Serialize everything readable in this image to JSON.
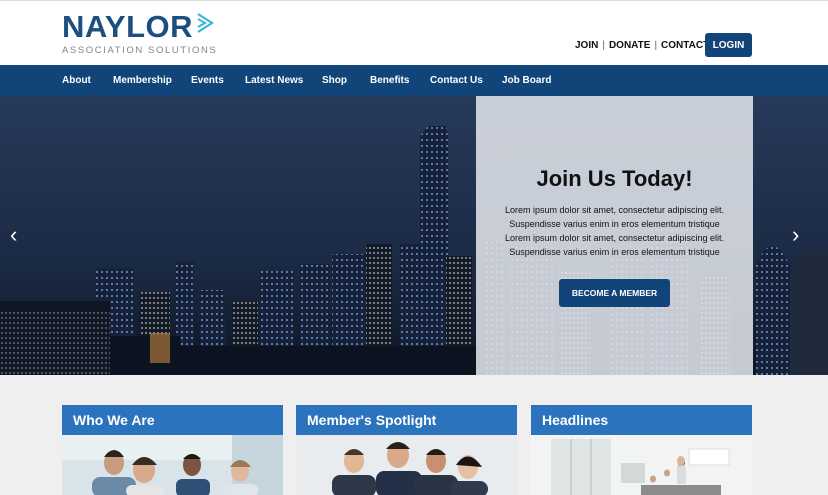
{
  "header": {
    "logo_word": "NAYLOR",
    "logo_sub": "ASSOCIATION SOLUTIONS",
    "util": {
      "join": "JOIN",
      "donate": "DONATE",
      "contact": "CONTACT US",
      "sep": "|"
    },
    "login": "LOGIN"
  },
  "nav": {
    "items": [
      "About",
      "Membership",
      "Events",
      "Latest News",
      "Shop",
      "Benefits",
      "Contact Us",
      "Job Board"
    ]
  },
  "hero": {
    "title": "Join Us Today!",
    "lines": [
      "Lorem ipsum dolor sit amet, consectetur adipiscing elit.",
      "Suspendisse varius enim in eros elementum tristique",
      "Lorem ipsum dolor sit amet, consectetur adipiscing elit.",
      "Suspendisse varius enim in eros elementum tristique"
    ],
    "button": "BECOME A MEMBER",
    "prev": "‹",
    "next": "›"
  },
  "cards": [
    {
      "title": "Who We Are"
    },
    {
      "title": "Member's Spotlight"
    },
    {
      "title": "Headlines"
    }
  ],
  "colors": {
    "brand": "#11457a",
    "card_header": "#2b73bc",
    "logo_accent": "#3cb4d8"
  }
}
